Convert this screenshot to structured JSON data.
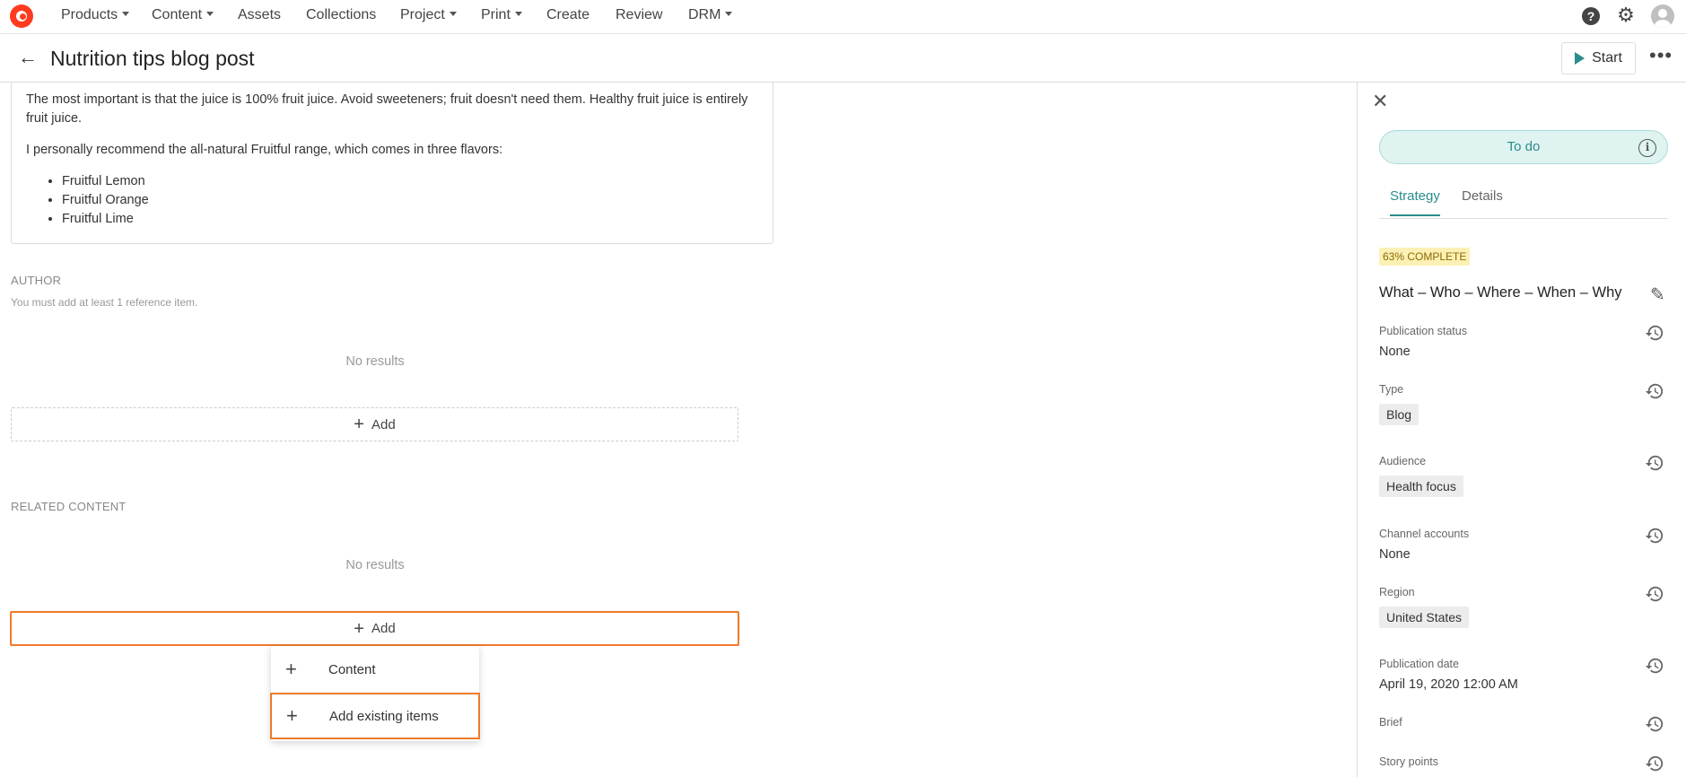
{
  "nav": {
    "items": [
      {
        "label": "Products",
        "has_caret": true
      },
      {
        "label": "Content",
        "has_caret": true
      },
      {
        "label": "Assets",
        "has_caret": false
      },
      {
        "label": "Collections",
        "has_caret": false
      },
      {
        "label": "Project",
        "has_caret": true
      },
      {
        "label": "Print",
        "has_caret": true
      },
      {
        "label": "Create",
        "has_caret": false
      },
      {
        "label": "Review",
        "has_caret": false
      },
      {
        "label": "DRM",
        "has_caret": true
      }
    ],
    "help_icon": "question-circle-icon",
    "settings_icon": "gear-icon",
    "avatar_icon": "user-avatar-icon"
  },
  "header": {
    "title": "Nutrition tips blog post",
    "start_label": "Start"
  },
  "body_text": {
    "p1": "The most important is that the juice is 100% fruit juice. Avoid sweeteners; fruit doesn't need them. Healthy fruit juice is entirely fruit juice.",
    "p2": "I personally recommend the all-natural Fruitful range, which comes in three flavors:",
    "bullets": [
      "Fruitful Lemon",
      "Fruitful Orange",
      "Fruitful Lime"
    ]
  },
  "author": {
    "label": "AUTHOR",
    "helper": "You must add at least 1 reference item.",
    "no_results": "No results",
    "add_label": "Add"
  },
  "related": {
    "label": "RELATED CONTENT",
    "no_results": "No results",
    "add_label": "Add",
    "menu": [
      {
        "label": "Content"
      },
      {
        "label": "Add existing items"
      }
    ]
  },
  "panel": {
    "status": "To do",
    "tabs": [
      "Strategy",
      "Details"
    ],
    "active_tab": "Strategy",
    "complete_badge": "63% COMPLETE",
    "strategy_title": "What – Who – Where – When – Why",
    "fields": {
      "publication_status": {
        "label": "Publication status",
        "value": "None"
      },
      "type": {
        "label": "Type",
        "value": "Blog"
      },
      "audience": {
        "label": "Audience",
        "value": "Health focus"
      },
      "channel_accounts": {
        "label": "Channel accounts",
        "value": "None"
      },
      "region": {
        "label": "Region",
        "value": "United States"
      },
      "publication_date": {
        "label": "Publication date",
        "value": "April 19, 2020 12:00 AM"
      },
      "brief": {
        "label": "Brief"
      },
      "story_points": {
        "label": "Story points"
      }
    }
  },
  "colors": {
    "accent": "#2a8c8c",
    "highlight": "#f07a28",
    "brand": "#ff3b1f"
  }
}
